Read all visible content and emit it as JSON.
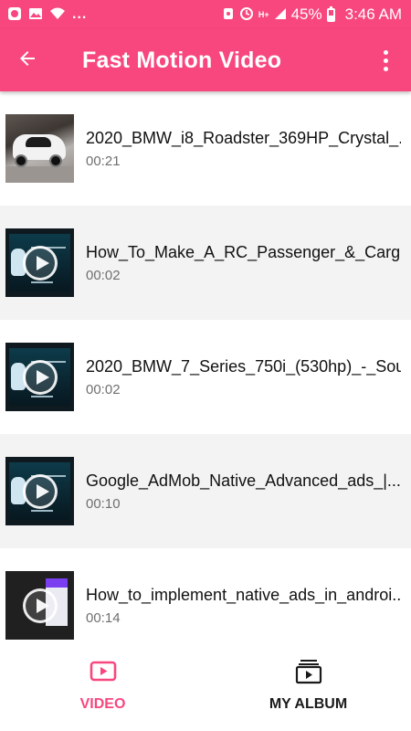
{
  "status_bar": {
    "battery": "45%",
    "time": "3:46 AM",
    "overflow_dots": "...",
    "signal_badge": "H+"
  },
  "app_bar": {
    "title": "Fast Motion Video",
    "back_icon": "arrow-back-icon",
    "menu_icon": "more-vert-icon"
  },
  "videos": [
    {
      "title": "2020_BMW_i8_Roadster_369HP_Crystal_...",
      "duration": "00:21",
      "thumb": "car"
    },
    {
      "title": "How_To_Make_A_RC_Passenger_&_Carg...",
      "duration": "00:02",
      "thumb": "dark"
    },
    {
      "title": "2020_BMW_7_Series_750i_(530hp)_-_Sou...",
      "duration": "00:02",
      "thumb": "dark"
    },
    {
      "title": "Google_AdMob_Native_Advanced_ads_|...",
      "duration": "00:10",
      "thumb": "dark"
    },
    {
      "title": "How_to_implement_native_ads_in_androi...",
      "duration": "00:14",
      "thumb": "phone"
    }
  ],
  "bottom_nav": {
    "video_label": "VIDEO",
    "album_label": "MY ALBUM",
    "active_tab": "VIDEO"
  },
  "colors": {
    "accent": "#f8477e",
    "row_alt": "#f3f3f3"
  }
}
